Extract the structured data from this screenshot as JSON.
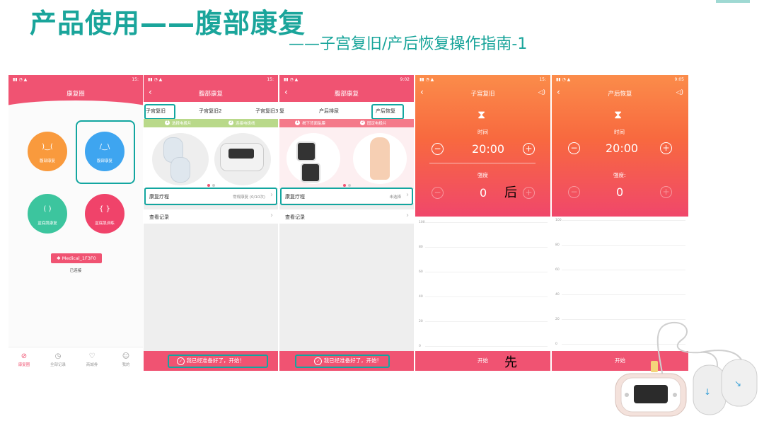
{
  "slide": {
    "title": "产品使用——腹部康复",
    "subtitle": "——子宫复旧/产后恢复操作指南-1",
    "annotation_after": "后",
    "annotation_first": "先",
    "teal": "#1aa59b",
    "pink": "#f05372",
    "orange": "#fb8c4a"
  },
  "screen1": {
    "status_right": "15:",
    "title": "康复圈",
    "cards": [
      {
        "label": "腹部康复",
        "color": "#f99a3d",
        "icon": "belly-icon"
      },
      {
        "label": "腹部康复",
        "color": "#3ea5f0",
        "icon": "abdomen-icon"
      },
      {
        "label": "盆底肌康复",
        "color": "#3cc59e",
        "icon": "pelvis-icon"
      },
      {
        "label": "盆底肌训练",
        "color": "#f0436a",
        "icon": "pelvis-train-icon"
      }
    ],
    "device_name": "Medical_1F3F0",
    "device_status": "已连接",
    "nav": [
      "康复圈",
      "全部记录",
      "商城券",
      "我的"
    ]
  },
  "screen2": {
    "status_right": "15:",
    "title": "腹部康复",
    "tabs": [
      "子宫复旧",
      "子宫复旧2",
      "子宫复旧3"
    ],
    "step1": "选择电极片",
    "step2": "连接电极线",
    "step1_num": "1",
    "step2_num": "2",
    "course_label": "康复疗程",
    "course_value": "常规康复 (0/10次)",
    "record_label": "查看记录",
    "start_button": "我已经准备好了，开始！"
  },
  "screen3": {
    "status_right": "9:02",
    "title": "腹部康复",
    "tabs": [
      "复",
      "产后排尿",
      "产后恢复"
    ],
    "step1": "揭下背面贴膜",
    "step2": "固定电极片",
    "step1_num": "1",
    "step2_num": "2",
    "course_label": "康复疗程",
    "course_value": "未选择",
    "record_label": "查看记录",
    "start_button": "我已经准备好了，开始!"
  },
  "screen4": {
    "status_right": "15:",
    "title": "子宫复旧",
    "time_label": "时间",
    "time_value": "20:00",
    "intensity_label": "强度",
    "intensity_value": "0",
    "y_ticks": [
      "100",
      "80",
      "60",
      "40",
      "20",
      "0"
    ],
    "start_button": "开始"
  },
  "screen5": {
    "status_right": "9:05",
    "title": "产后恢复",
    "time_label": "时间",
    "time_value": "20:00",
    "intensity_label": "强度:",
    "intensity_value": "0",
    "y_ticks": [
      "100",
      "80",
      "60",
      "40",
      "20",
      "0"
    ],
    "start_button": "开始"
  }
}
